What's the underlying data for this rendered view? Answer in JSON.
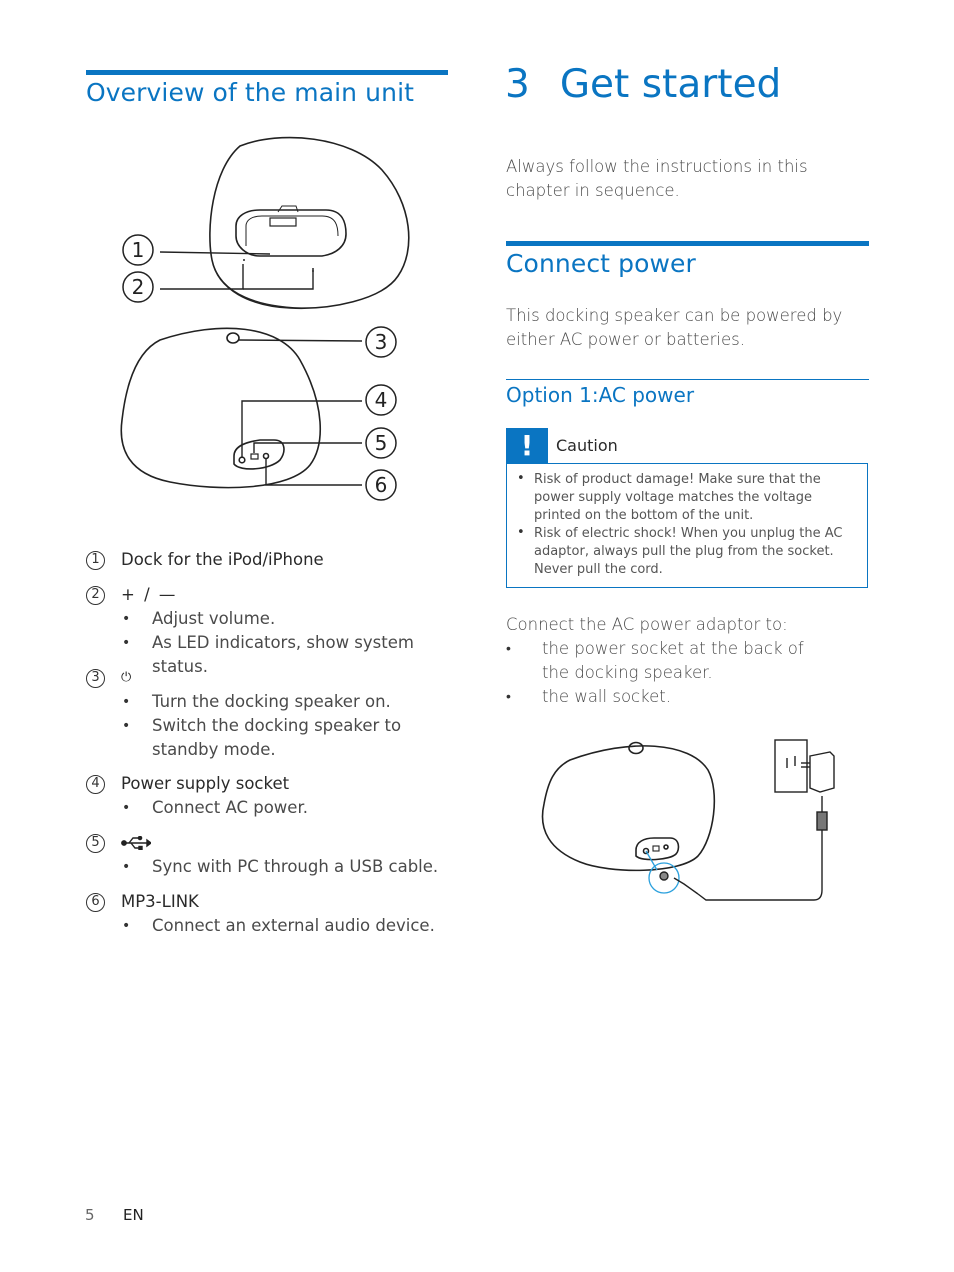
{
  "left": {
    "section_title": "Overview of the main unit",
    "figure_callouts": [
      "1",
      "2",
      "3",
      "4",
      "5",
      "6"
    ],
    "items": [
      {
        "number": "1",
        "title": "Dock for the iPod/iPhone",
        "bullets": []
      },
      {
        "number": "2",
        "title": "+ / —",
        "bullets": [
          "Adjust volume.",
          "As LED indicators, show system status."
        ]
      },
      {
        "number": "3",
        "title": "⏻",
        "icon": "power-icon",
        "bullets": [
          "Turn the docking speaker on.",
          "Switch the docking speaker to standby mode."
        ]
      },
      {
        "number": "4",
        "title": "Power supply socket",
        "bullets": [
          "Connect AC power."
        ]
      },
      {
        "number": "5",
        "title": "",
        "icon": "usb-icon",
        "bullets": [
          "Sync with PC through a USB cable."
        ]
      },
      {
        "number": "6",
        "title": "MP3-LINK",
        "bullets": [
          "Connect an external audio device."
        ]
      }
    ]
  },
  "right": {
    "chapter_number": "3",
    "chapter_title": "Get started",
    "intro": "Always follow the instructions in this chapter in sequence.",
    "section_title": "Connect power",
    "section_text": "This docking speaker can be powered by either AC power or batteries.",
    "subsection_title": "Option 1:AC power",
    "caution": {
      "icon": "exclamation-icon",
      "icon_glyph": "!",
      "title": "Caution",
      "bullets": [
        "Risk of product damage! Make sure that the power supply voltage matches the voltage printed on the bottom of the unit.",
        "Risk of electric shock! When you unplug the AC adaptor, always pull the plug from the socket. Never pull the cord."
      ]
    },
    "connect_intro": "Connect the AC power adaptor to:",
    "connect_bullets": [
      "the power socket at the back of the docking speaker.",
      "the wall socket."
    ]
  },
  "footer": {
    "page_number": "5",
    "language": "EN"
  },
  "colors": {
    "accent": "#0a75c2",
    "text": "#4a4a4a"
  }
}
